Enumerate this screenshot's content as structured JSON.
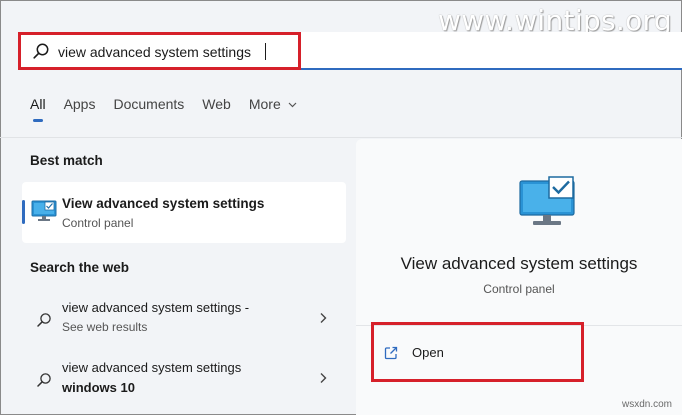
{
  "watermark": "www.wintips.org",
  "search": {
    "value": "view advanced system settings",
    "icon": "search-icon"
  },
  "tabs": [
    {
      "label": "All",
      "active": true
    },
    {
      "label": "Apps",
      "active": false
    },
    {
      "label": "Documents",
      "active": false
    },
    {
      "label": "Web",
      "active": false
    },
    {
      "label": "More",
      "active": false
    }
  ],
  "best_match": {
    "section_title": "Best match",
    "title": "View advanced system settings",
    "subtitle": "Control panel",
    "icon": "monitor-settings-icon"
  },
  "search_web": {
    "section_title": "Search the web",
    "items": [
      {
        "line1": "view advanced system settings -",
        "line2": "See web results"
      },
      {
        "line1": "view advanced system settings",
        "line2": "windows 10"
      }
    ]
  },
  "preview": {
    "title": "View advanced system settings",
    "subtitle": "Control panel",
    "icon": "monitor-check-icon",
    "actions": [
      {
        "label": "Open",
        "icon": "open-external-icon"
      }
    ]
  },
  "footer_watermark": "wsxdn.com",
  "colors": {
    "accent": "#2f6bbf",
    "highlight_box": "#d6202a",
    "background": "#f2f4f7"
  }
}
